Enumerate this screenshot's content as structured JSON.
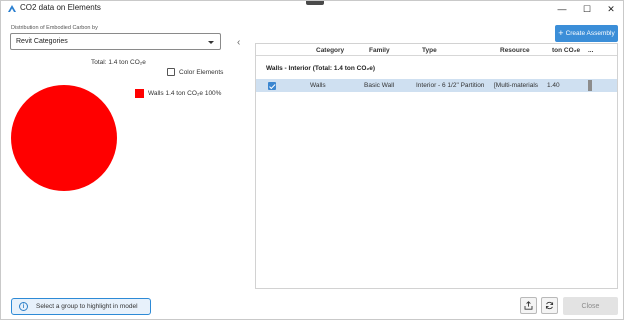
{
  "window": {
    "title": "CO2 data on Elements",
    "controls": {
      "minimize": "—",
      "maximize": "☐",
      "close": "✕"
    }
  },
  "distribution": {
    "label": "Distribution of Embodied Carbon by",
    "selected": "Revit Categories"
  },
  "chart_header": {
    "total": "Total: 1.4 ton CO₂e",
    "color_elements_label": "Color Elements",
    "color_elements_checked": false
  },
  "chart_data": {
    "type": "pie",
    "title": "Total: 1.4 ton CO₂e",
    "categories": [
      "Walls"
    ],
    "values": [
      1.4
    ],
    "unit": "ton CO₂e",
    "colors": [
      "#ff0000"
    ],
    "legend": [
      {
        "label": "Walls 1.4 ton CO₂e 100%",
        "color": "#ff0000"
      }
    ],
    "legend_position": "right"
  },
  "status": {
    "text": "Select a group to highlight in model",
    "icon": "info-icon"
  },
  "toolbar": {
    "create_assembly_label": "Create Assembly",
    "create_assembly_icon": "plus-icon",
    "accent_color": "#3b8ed8"
  },
  "table": {
    "columns": [
      "Category",
      "Family",
      "Type",
      "Resource",
      "ton CO₂e",
      "..."
    ],
    "group_header": "Walls - Interior (Total: 1.4 ton CO₂e)",
    "rows": [
      {
        "selected": true,
        "category": "Walls",
        "family": "Basic Wall",
        "type": "Interior - 6 1/2\" Partition",
        "resource": "[Multi-materials",
        "co2": "1.40"
      }
    ]
  },
  "footer": {
    "export_icon": "export-icon",
    "refresh_icon": "refresh-icon",
    "close_label": "Close"
  }
}
